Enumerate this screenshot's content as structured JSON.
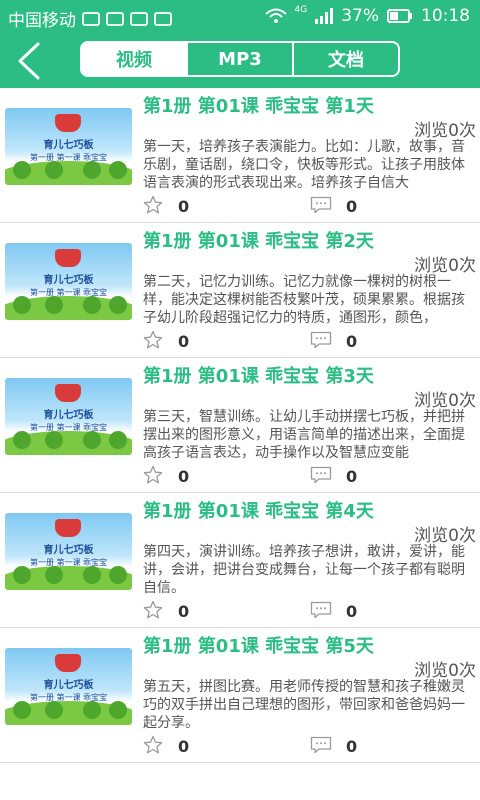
{
  "status_bar": {
    "carrier": "中国移动",
    "battery": "37%",
    "time": "10:18",
    "network": "4G"
  },
  "tabs": [
    {
      "label": "视频",
      "active": true
    },
    {
      "label": "MP3",
      "active": false
    },
    {
      "label": "文档",
      "active": false
    }
  ],
  "thumbnail": {
    "line1": "育儿七巧板",
    "line2": "第一册 第一课 乖宝宝"
  },
  "items": [
    {
      "title": "第1册 第01课 乖宝宝 第1天",
      "views": "浏览0次",
      "desc": "第一天，培养孩子表演能力。比如：儿歌，故事，音乐剧，童话剧，绕口令，快板等形式。让孩子用肢体语言表演的形式表现出来。培养孩子自信大",
      "likes": "0",
      "comments": "0"
    },
    {
      "title": "第1册 第01课 乖宝宝 第2天",
      "views": "浏览0次",
      "desc": "第二天，记忆力训练。记忆力就像一棵树的树根一样，能决定这棵树能否枝繁叶茂，硕果累累。根据孩子幼儿阶段超强记忆力的特质，通图形，颜色，",
      "likes": "0",
      "comments": "0"
    },
    {
      "title": "第1册 第01课 乖宝宝 第3天",
      "views": "浏览0次",
      "desc": "第三天，智慧训练。让幼儿手动拼摆七巧板，并把拼摆出来的图形意义，用语言简单的描述出来，全面提高孩子语言表达，动手操作以及智慧应变能",
      "likes": "0",
      "comments": "0"
    },
    {
      "title": "第1册 第01课 乖宝宝 第4天",
      "views": "浏览0次",
      "desc": "第四天，演讲训练。培养孩子想讲，敢讲，爱讲，能讲，会讲，把讲台变成舞台，让每一个孩子都有聪明自信。",
      "likes": "0",
      "comments": "0"
    },
    {
      "title": "第1册 第01课 乖宝宝 第5天",
      "views": "浏览0次",
      "desc": "第五天，拼图比赛。用老师传授的智慧和孩子稚嫩灵巧的双手拼出自己理想的图形，带回家和爸爸妈妈一起分享。",
      "likes": "0",
      "comments": "0"
    }
  ]
}
